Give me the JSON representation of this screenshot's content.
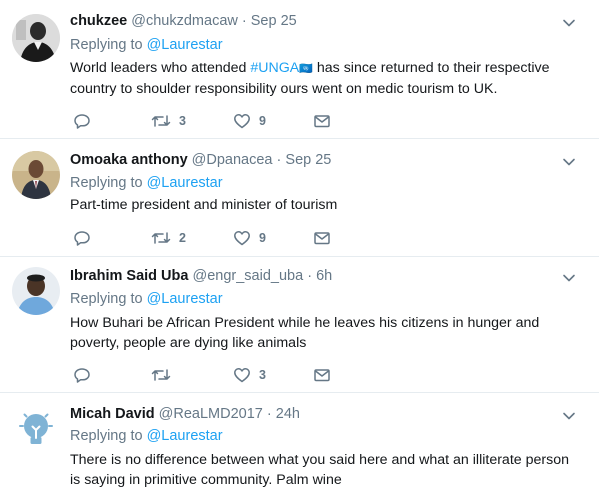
{
  "tweets": [
    {
      "name": "chukzee",
      "handle": "@chukzdmacaw",
      "dot": "·",
      "time": "Sep 25",
      "replying_prefix": "Replying to",
      "replying_mention": "@Laurestar",
      "text_before": "World leaders who attended ",
      "hashtag": "#UNGA",
      "hashtag_emoji": "🇺🇳",
      "text_after": " has since returned to their respective country to shoulder responsibility ours went on medic tourism to UK.",
      "reply_count": "",
      "retweet_count": "3",
      "like_count": "9"
    },
    {
      "name": "Omoaka anthony",
      "handle": "@Dpanacea",
      "dot": "·",
      "time": "Sep 25",
      "replying_prefix": "Replying to",
      "replying_mention": "@Laurestar",
      "text": "Part-time president and minister of tourism",
      "reply_count": "",
      "retweet_count": "2",
      "like_count": "9"
    },
    {
      "name": "Ibrahim Said Uba",
      "handle": "@engr_said_uba",
      "dot": "·",
      "time": "6h",
      "replying_prefix": "Replying to",
      "replying_mention": "@Laurestar",
      "text": "How Buhari be African President while he leaves his citizens in hunger and poverty,  people are dying like animals",
      "reply_count": "",
      "retweet_count": "",
      "like_count": "3"
    },
    {
      "name": "Micah David",
      "handle": "@ReaLMD2017",
      "dot": "·",
      "time": "24h",
      "replying_prefix": "Replying to",
      "replying_mention": "@Laurestar",
      "text": "There is no difference between what you said here and what an illiterate person is saying in  primitive community. Palm wine"
    }
  ],
  "colors": {
    "accent": "#1da1f2",
    "secondary_text": "#657786",
    "primary_text": "#14171a",
    "divider": "#e6ecf0"
  },
  "icons": {
    "reply": "reply-icon",
    "retweet": "retweet-icon",
    "like": "heart-icon",
    "message": "envelope-icon",
    "more": "chevron-down-icon"
  }
}
